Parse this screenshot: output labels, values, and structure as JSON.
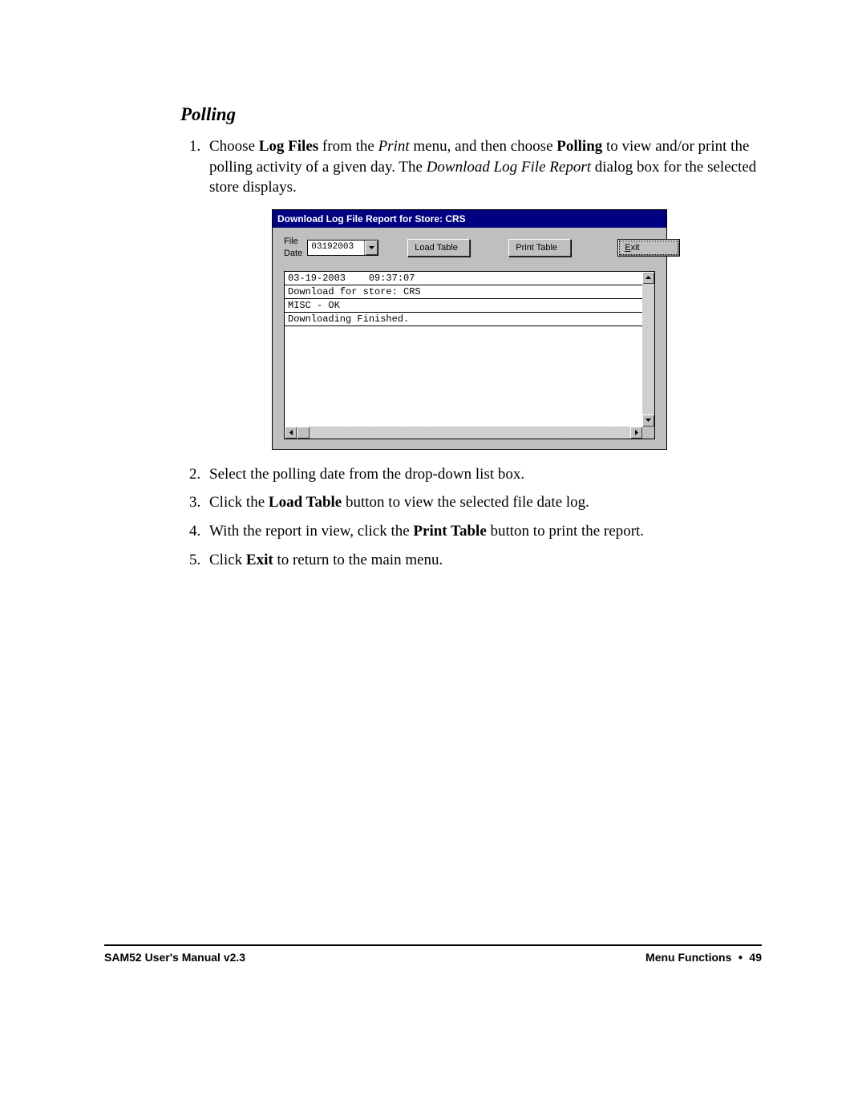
{
  "section_title": "Polling",
  "steps": {
    "s1_a": "Choose ",
    "s1_b_bold": "Log Files",
    "s1_c": " from the ",
    "s1_d_ital": "Print",
    "s1_e": " menu, and then choose ",
    "s1_f_bold": "Polling",
    "s1_g": " to view and/or print the polling activity of a given day.  The ",
    "s1_h_ital": "Download Log File Report",
    "s1_i": " dialog box for the selected store displays.",
    "s2": "Select the polling date from the drop-down list box.",
    "s3_a": "Click the ",
    "s3_b_bold": "Load Table",
    "s3_c": " button to view the selected file date log.",
    "s4_a": "With the report in view, click the ",
    "s4_b_bold": "Print Table",
    "s4_c": " button to print the report.",
    "s5_a": "Click ",
    "s5_b_bold": "Exit",
    "s5_c": " to return to the main menu."
  },
  "dialog": {
    "title": "Download Log File Report for Store:  CRS",
    "file_date_label": "File Date",
    "file_date_value": "03192003",
    "buttons": {
      "load": "Load Table",
      "print": "Print Table",
      "exit": "Exit"
    },
    "log_lines": [
      "03-19-2003    09:37:07",
      "Download for store: CRS",
      "MISC - OK",
      "Downloading Finished."
    ]
  },
  "footer": {
    "left": "SAM52 User's Manual v2.3",
    "right_section": "Menu Functions",
    "right_page": "49"
  }
}
